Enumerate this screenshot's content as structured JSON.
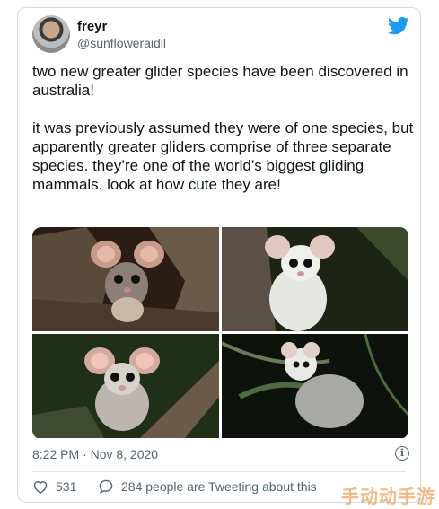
{
  "tweet": {
    "author_name": "freyr",
    "author_handle": "@sunfloweraidil",
    "paragraph_1": "two new greater glider species have been discovered in australia!",
    "paragraph_2": "it was previously assumed they were of one species, but apparently greater gliders comprise of three separate species. they’re one of the world’s biggest gliding mammals. look at how cute they are!",
    "timestamp": "8:22 PM · Nov 8, 2020",
    "likes": "531",
    "replies_label": "284 people are Tweeting about this"
  },
  "icons": {
    "platform": "twitter-bird-icon",
    "info": "info-icon",
    "like": "heart-icon",
    "reply": "speech-bubble-icon"
  },
  "colors": {
    "twitter_blue": "#1d9bf0",
    "secondary_text": "#536471",
    "primary_text": "#0f1419"
  },
  "watermark": "手动动手游"
}
